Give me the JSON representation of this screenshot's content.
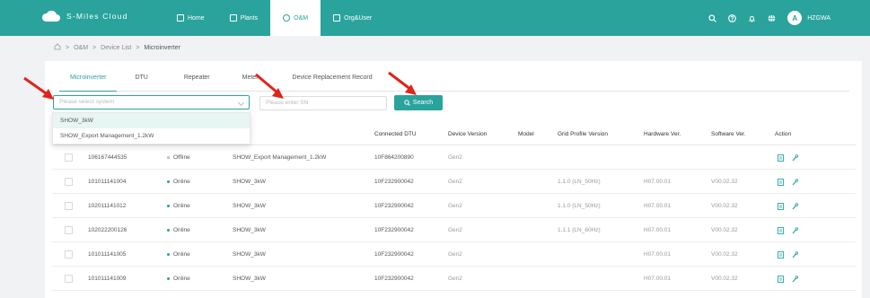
{
  "brand": {
    "name": "S-Miles Cloud"
  },
  "nav": [
    {
      "label": "Home",
      "icon": "home-icon"
    },
    {
      "label": "Plants",
      "icon": "plants-icon"
    },
    {
      "label": "O&M",
      "icon": "tools-icon"
    },
    {
      "label": "Org&User",
      "icon": "org-icon"
    }
  ],
  "user": {
    "initial": "A",
    "name": "HZGWA"
  },
  "breadcrumb": [
    "O&M",
    "Device List",
    "Microinverter"
  ],
  "tabs": [
    "Microinverter",
    "DTU",
    "Repeater",
    "Meter",
    "Device Replacement Record"
  ],
  "filters": {
    "system_placeholder": "Please select system",
    "sn_placeholder": "Please enter SN",
    "search_label": "Search"
  },
  "dropdown": [
    "SHOW_3kW",
    "SHOW_Export Management_1.2kW"
  ],
  "columns": [
    "Connected DTU",
    "Device Version",
    "Model",
    "Grid Profile Version",
    "Hardware Ver.",
    "Software Ver.",
    "Action"
  ],
  "rows": [
    {
      "sn": "106167444535",
      "status": "Offline",
      "system": "SHOW_Export Management_1.2kW",
      "dtu": "10F864200890",
      "version": "Gen2",
      "model": "",
      "grid": "",
      "hw": "",
      "sw": ""
    },
    {
      "sn": "101011141004",
      "status": "Online",
      "system": "SHOW_3kW",
      "dtu": "10F232900042",
      "version": "Gen2",
      "model": "",
      "grid": "1.1.0 (LN_50Hz)",
      "hw": "H07.00.01",
      "sw": "V00.02.32"
    },
    {
      "sn": "102011141012",
      "status": "Online",
      "system": "SHOW_3kW",
      "dtu": "10F232900042",
      "version": "Gen2",
      "model": "",
      "grid": "1.1.0 (LN_50Hz)",
      "hw": "H07.00.01",
      "sw": "V00.02.32"
    },
    {
      "sn": "102022200126",
      "status": "Online",
      "system": "SHOW_3kW",
      "dtu": "10F232900042",
      "version": "Gen2",
      "model": "",
      "grid": "1.1.1 (LN_60Hz)",
      "hw": "H07.00.01",
      "sw": "V00.02.32"
    },
    {
      "sn": "101011141005",
      "status": "Online",
      "system": "SHOW_3kW",
      "dtu": "10F232900042",
      "version": "Gen2",
      "model": "",
      "grid": "",
      "hw": "H07.00.01",
      "sw": "V00.02.32"
    },
    {
      "sn": "101011141009",
      "status": "Online",
      "system": "SHOW_3kW",
      "dtu": "10F232900042",
      "version": "Gen2",
      "model": "",
      "grid": "",
      "hw": "H07.00.01",
      "sw": "V00.02.32"
    }
  ],
  "colors": {
    "accent": "#2aa39c",
    "online": "#2aa39c",
    "offline": "#bbbbbb",
    "arrow": "#e0231c"
  }
}
